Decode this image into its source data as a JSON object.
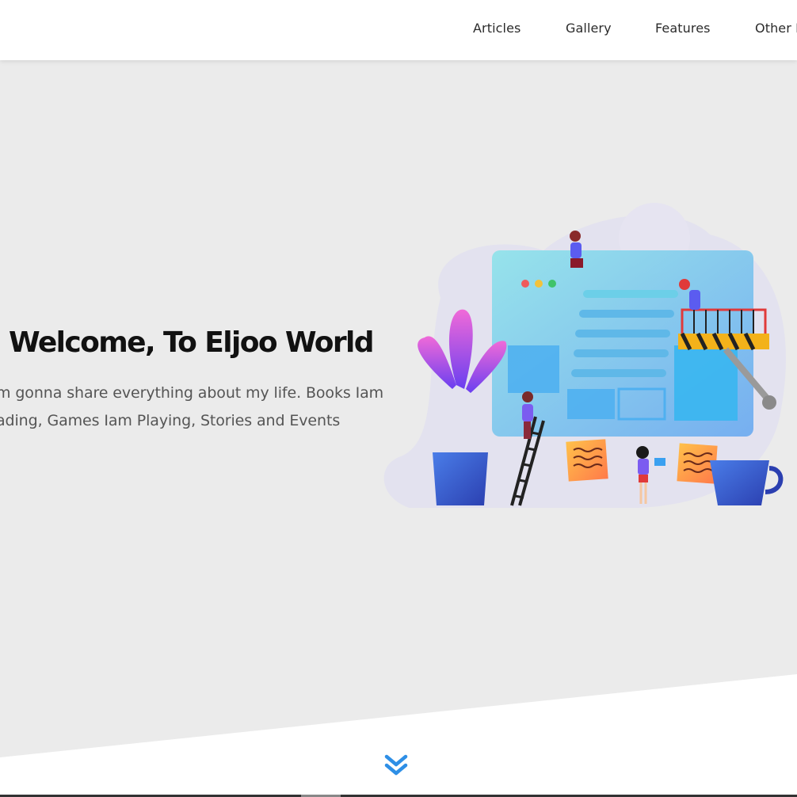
{
  "nav": {
    "items": [
      {
        "label": "Articles"
      },
      {
        "label": "Gallery"
      },
      {
        "label": "Features"
      },
      {
        "label": "Other L"
      }
    ]
  },
  "hero": {
    "title": "Welcome, To Eljoo World",
    "description_lines": [
      "m gonna share everything about my life. Books Iam",
      "ading, Games Iam Playing, Stories and Events"
    ],
    "illustration_icon": "website-construction-illustration"
  },
  "scroll": {
    "icon": "double-chevron-down-icon",
    "color": "#2e8fe6"
  },
  "colors": {
    "hero_background": "#ebebeb",
    "header_background": "#ffffff",
    "accent": "#2e8fe6"
  }
}
